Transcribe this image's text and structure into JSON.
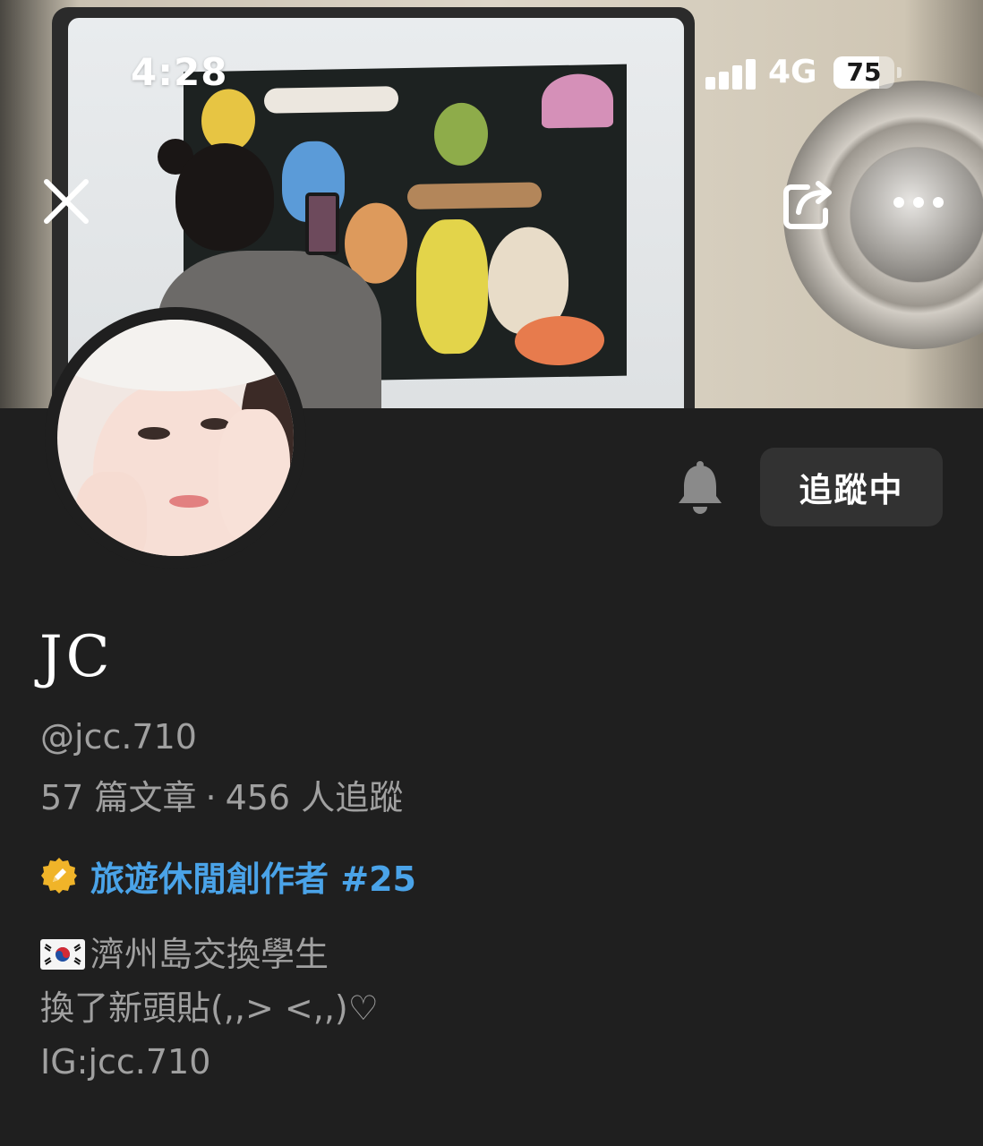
{
  "status_bar": {
    "time": "4:28",
    "network": "4G",
    "battery_percent": "75",
    "battery_level": 0.75
  },
  "nav": {
    "close_icon": "close-icon",
    "share_icon": "share-icon",
    "more_icon": "more-horizontal-icon"
  },
  "profile": {
    "display_name": "JC",
    "username": "@jcc.710",
    "posts_count": "57",
    "posts_label": "篇文章",
    "separator": "·",
    "followers_count": "456",
    "followers_label": "人追蹤",
    "creator_badge": "旅遊休閒創作者 #25",
    "bio_lines": [
      "濟州島交換學生",
      "換了新頭貼(,,> <,,)♡",
      "IG:jcc.710"
    ]
  },
  "actions": {
    "notify_icon": "bell-icon",
    "follow_label": "追蹤中"
  },
  "colors": {
    "background": "#1f1f1f",
    "follow_button_bg": "#323232",
    "badge_text": "#4aa3e8",
    "secondary_text": "#a0a0a0"
  }
}
